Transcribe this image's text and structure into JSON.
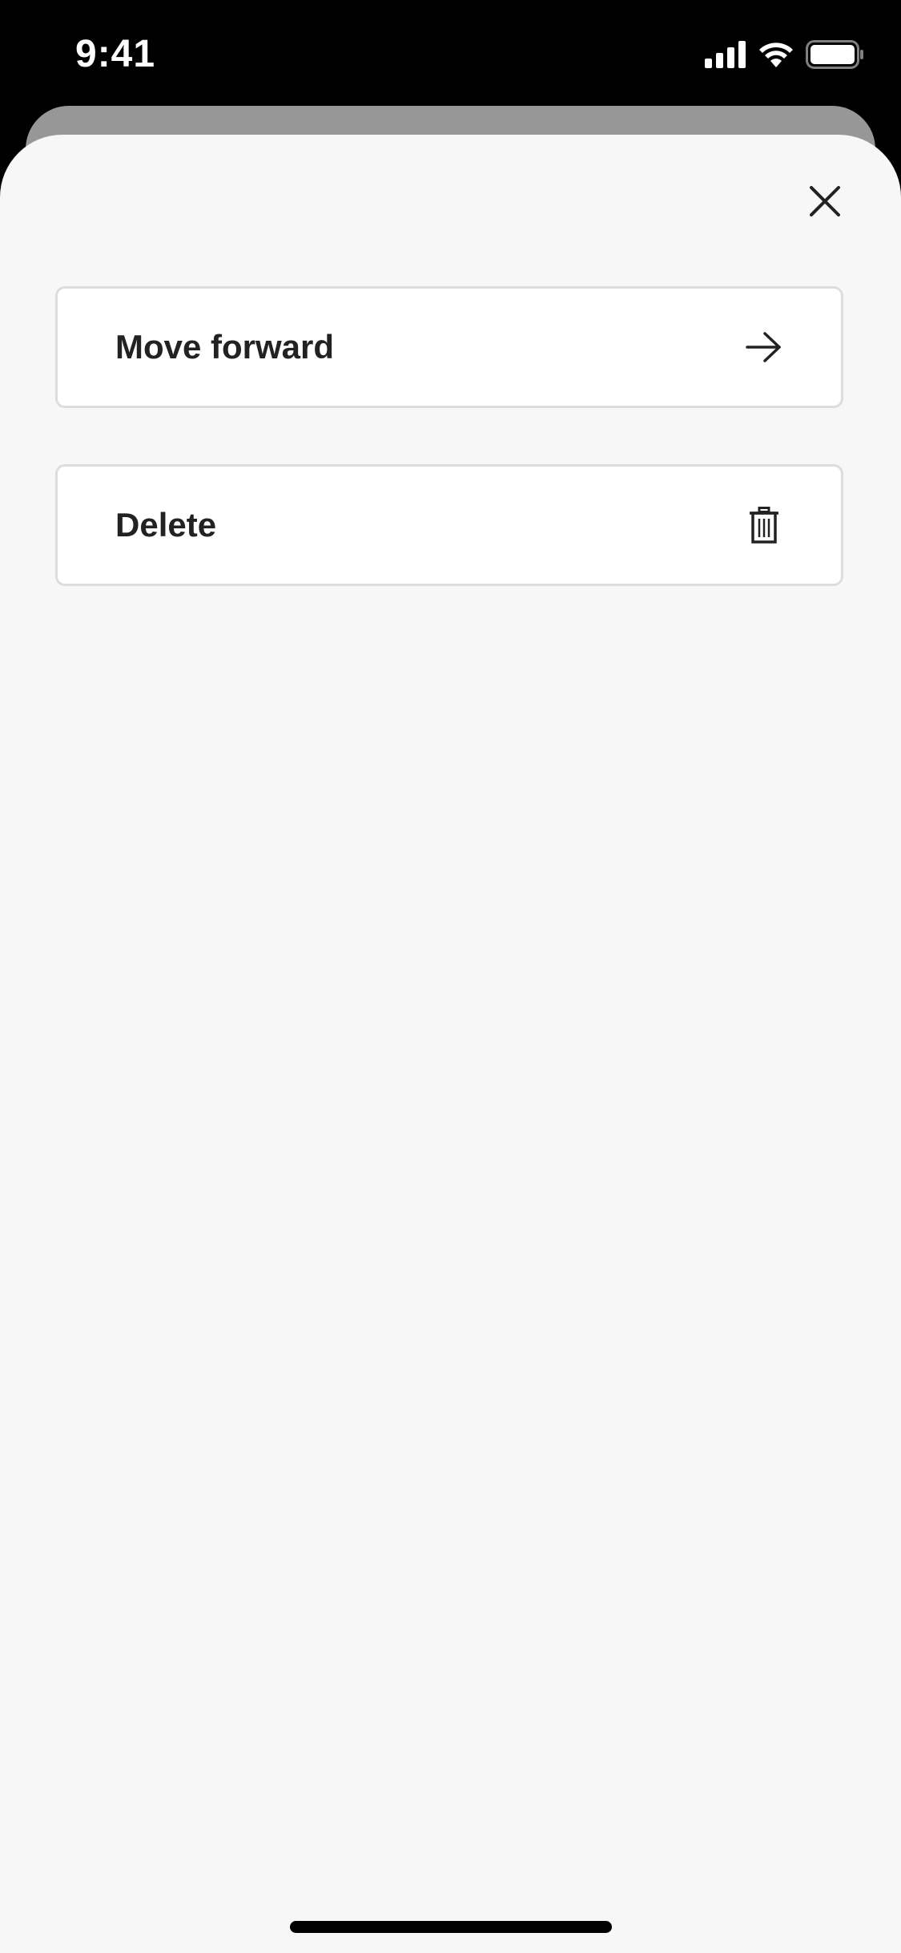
{
  "status_bar": {
    "time": "9:41",
    "icons": [
      "cellular-signal-icon",
      "wifi-icon",
      "battery-icon"
    ]
  },
  "sheet": {
    "close_icon": "close-icon",
    "options": [
      {
        "label": "Move forward",
        "icon": "arrow-right-icon"
      },
      {
        "label": "Delete",
        "icon": "trash-icon"
      }
    ]
  },
  "colors": {
    "sheet_background": "#f7f7f7",
    "card_background": "#ffffff",
    "card_border": "#dddddd",
    "text": "#222222",
    "back_sheet": "#979797"
  }
}
